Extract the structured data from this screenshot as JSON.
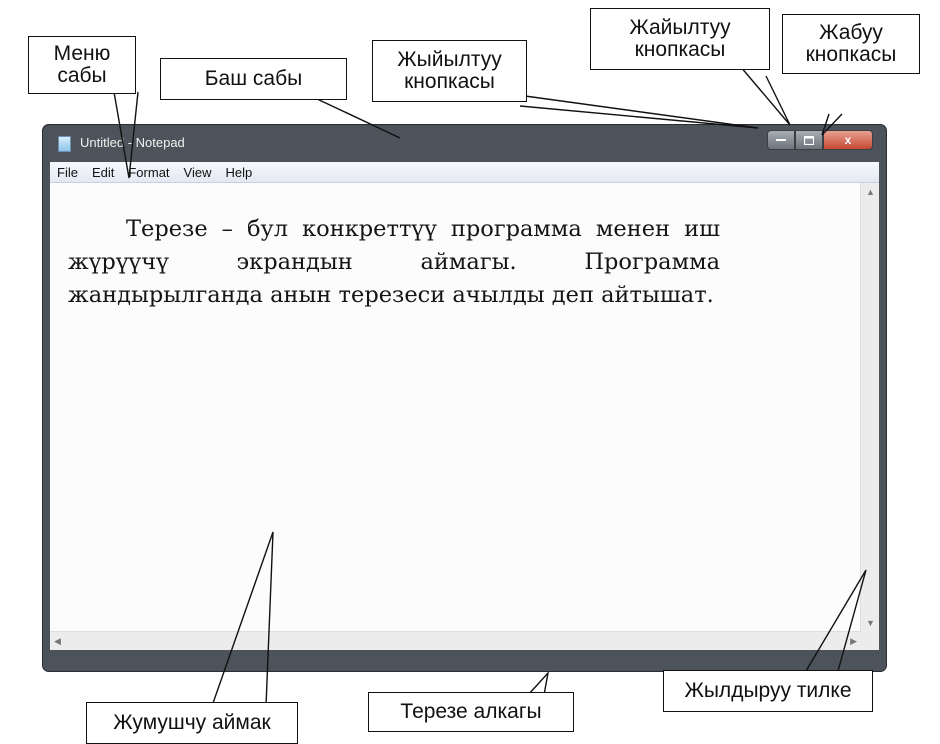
{
  "window": {
    "title": "Untitled - Notepad",
    "menu": [
      "File",
      "Edit",
      "Format",
      "View",
      "Help"
    ],
    "close_glyph": "x",
    "body_text": "Терезе – бул конкреттүү программа менен иш жүрүүчү экрандын аймагы. Программа жандырылганда анын терезеси ачылды деп айтышат."
  },
  "callouts": {
    "menu_bar": [
      "Меню",
      "сабы"
    ],
    "title_bar": "Баш сабы",
    "minimize": [
      "Жыйылтуу",
      "кнопкасы"
    ],
    "maximize": [
      "Жайылтуу",
      "кнопкасы"
    ],
    "close": [
      "Жабуу",
      "кнопкасы"
    ],
    "work_area": "Жумушчу аймак",
    "border": "Терезе алкагы",
    "scrollbar": "Жылдыруу тилке"
  },
  "icons": [
    "notepad-icon",
    "minimize-icon",
    "maximize-icon",
    "close-icon",
    "scroll-up-icon",
    "scroll-down-icon",
    "scroll-left-icon",
    "scroll-right-icon"
  ]
}
